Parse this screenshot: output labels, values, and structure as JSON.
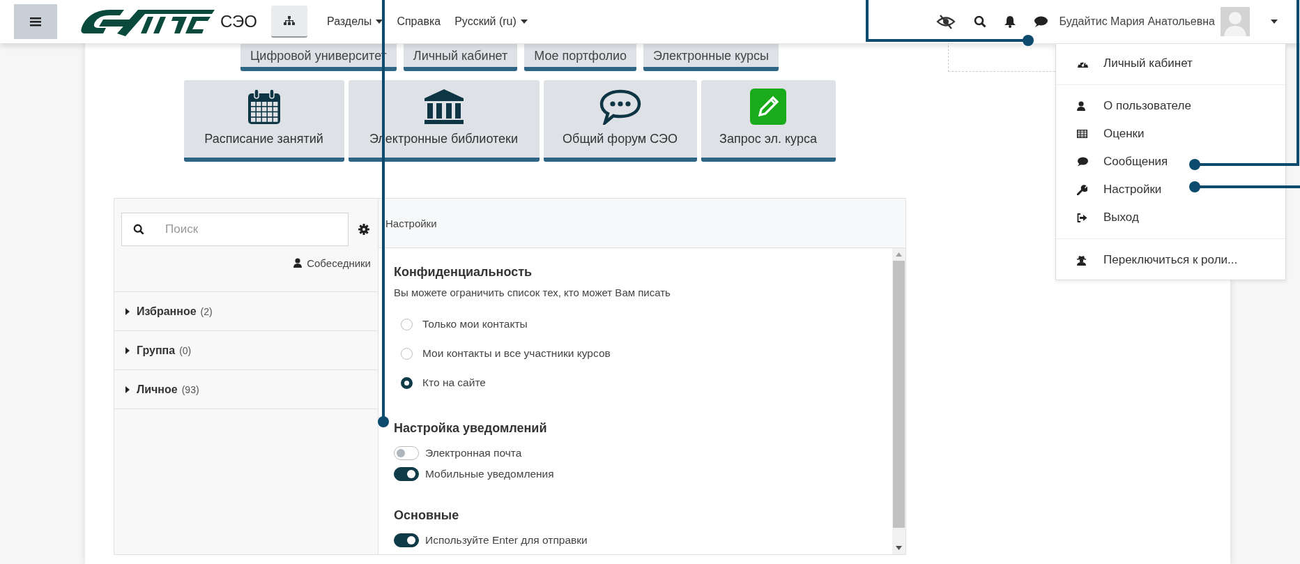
{
  "navbar": {
    "brand": "СЭО",
    "menu": [
      {
        "label": "Разделы",
        "dropdown": true
      },
      {
        "label": "Справка",
        "dropdown": false
      },
      {
        "label": "Русский (ru)",
        "dropdown": true
      }
    ],
    "user_name": "Будайтис Мария Анатольевна"
  },
  "tiles_top": [
    "Цифровой университет",
    "Личный кабинет",
    "Мое портфолио",
    "Электронные курсы"
  ],
  "tiles": [
    "Расписание занятий",
    "Электронные библиотеки",
    "Общий форум СЭО",
    "Запрос эл. курса"
  ],
  "messaging": {
    "search": {
      "placeholder": "Поиск"
    },
    "contacts_link": "Собеседники",
    "groups": [
      {
        "label": "Избранное",
        "count": "(2)",
        "expanded": false
      },
      {
        "label": "Группа",
        "count": "(0)",
        "expanded": false
      },
      {
        "label": "Личное",
        "count": "(93)",
        "expanded": false
      }
    ],
    "settings": {
      "title": "Настройки",
      "sections": [
        {
          "heading": "Конфиденциальность",
          "description": "Вы можете ограничить список тех, кто может Вам писать",
          "options": [
            {
              "kind": "radio",
              "label": "Только мои контакты",
              "selected": false
            },
            {
              "kind": "radio",
              "label": "Мои контакты и все участники курсов",
              "selected": false
            },
            {
              "kind": "radio",
              "label": "Кто на сайте",
              "selected": true
            }
          ]
        },
        {
          "heading": "Настройка уведомлений",
          "options": [
            {
              "kind": "toggle",
              "label": "Электронная почта",
              "on": false
            },
            {
              "kind": "toggle",
              "label": "Мобильные уведомления",
              "on": true
            }
          ]
        },
        {
          "heading": "Основные",
          "options": [
            {
              "kind": "toggle",
              "label": "Используйте Enter для отправки",
              "on": true
            }
          ]
        }
      ]
    }
  },
  "user_menu": {
    "groups": [
      [
        "Личный кабинет"
      ],
      [
        "О пользователе",
        "Оценки",
        "Сообщения",
        "Настройки",
        "Выход"
      ],
      [
        "Переключиться к роли..."
      ]
    ]
  }
}
